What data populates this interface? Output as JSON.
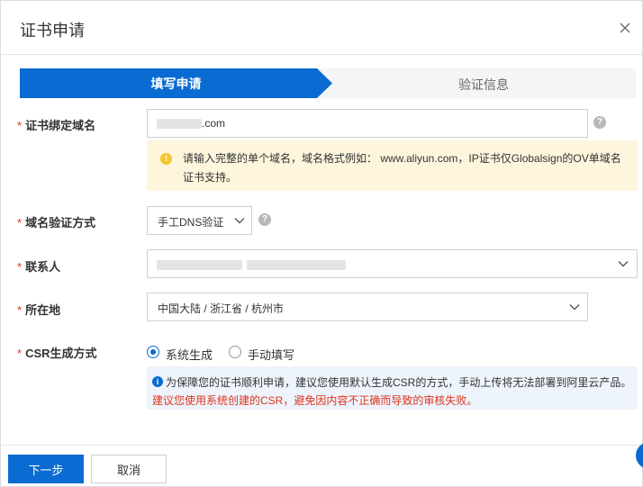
{
  "dialog": {
    "title": "证书申请"
  },
  "steps": [
    {
      "label": "填写申请",
      "active": true
    },
    {
      "label": "验证信息",
      "active": false
    }
  ],
  "form": {
    "domain": {
      "label": "证书绑定域名",
      "value": ".com",
      "help_icon": "question-circle-icon"
    },
    "domain_tip": "请输入完整的单个域名，域名格式例如： www.aliyun.com，IP证书仅Globalsign的OV单域名证书支持。",
    "verify_method": {
      "label": "域名验证方式",
      "value": "手工DNS验证",
      "help_icon": "question-circle-icon"
    },
    "contact": {
      "label": "联系人"
    },
    "location": {
      "label": "所在地",
      "value": "中国大陆 / 浙江省 / 杭州市"
    },
    "csr": {
      "label": "CSR生成方式",
      "options": [
        {
          "label": "系统生成",
          "selected": true
        },
        {
          "label": "手动填写",
          "selected": false
        }
      ],
      "tip_line1": "为保障您的证书顺利申请，建议您使用默认生成CSR的方式，手动上传将无法部署到阿里云产品。",
      "tip_line2": "建议您使用系统创建的CSR，避免因内容不正确而导致的审核失败。"
    },
    "required_mark": "*"
  },
  "footer": {
    "next_label": "下一步",
    "cancel_label": "取消"
  },
  "colors": {
    "primary": "#0a6bd2",
    "required": "#e0321c",
    "warning_bg": "#fdf6dd",
    "info_bg": "#eef4fb"
  }
}
